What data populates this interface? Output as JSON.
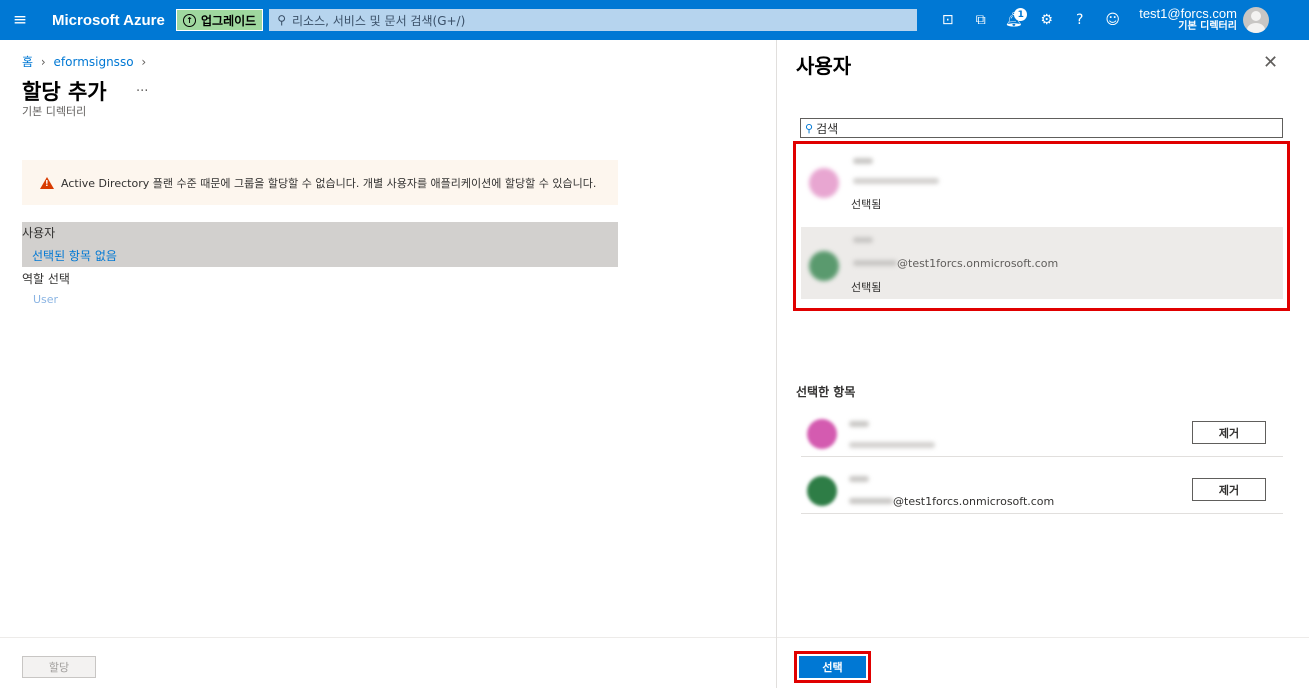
{
  "topbar": {
    "brand": "Microsoft Azure",
    "upgrade_label": "업그레이드",
    "search_placeholder": "리소스, 서비스 및 문서 검색(G+/)",
    "notification_count": "1",
    "account_email": "test1@forcs.com",
    "account_directory": "기본 디렉터리"
  },
  "breadcrumb": {
    "home": "홈",
    "app": "eformsignsso"
  },
  "page": {
    "title": "할당 추가",
    "more": "...",
    "subtitle": "기본 디렉터리",
    "warning": "Active Directory 플랜 수준 때문에 그룹을 할당할 수 없습니다. 개별 사용자를 애플리케이션에 할당할 수 있습니다.",
    "users_label": "사용자",
    "users_value": "선택된 항목 없음",
    "role_label": "역할 선택",
    "role_value": "User",
    "assign_button": "할당"
  },
  "panel": {
    "title": "사용자",
    "search_placeholder": "검색",
    "results": [
      {
        "email_suffix": "",
        "status": "선택됨",
        "avatar_color": "#e8a6d1"
      },
      {
        "email_suffix": "@test1forcs.onmicrosoft.com",
        "status": "선택됨",
        "avatar_color": "#5a9a6e"
      }
    ],
    "selected_header": "선택한 항목",
    "selected": [
      {
        "email_suffix": "",
        "remove_label": "제거",
        "avatar_color": "#d45bb0"
      },
      {
        "email_suffix": "@test1forcs.onmicrosoft.com",
        "remove_label": "제거",
        "avatar_color": "#2e7d46"
      }
    ],
    "select_button": "선택"
  },
  "colors": {
    "accent": "#0078d4",
    "highlight": "#e00000",
    "warning": "#d83b01"
  }
}
